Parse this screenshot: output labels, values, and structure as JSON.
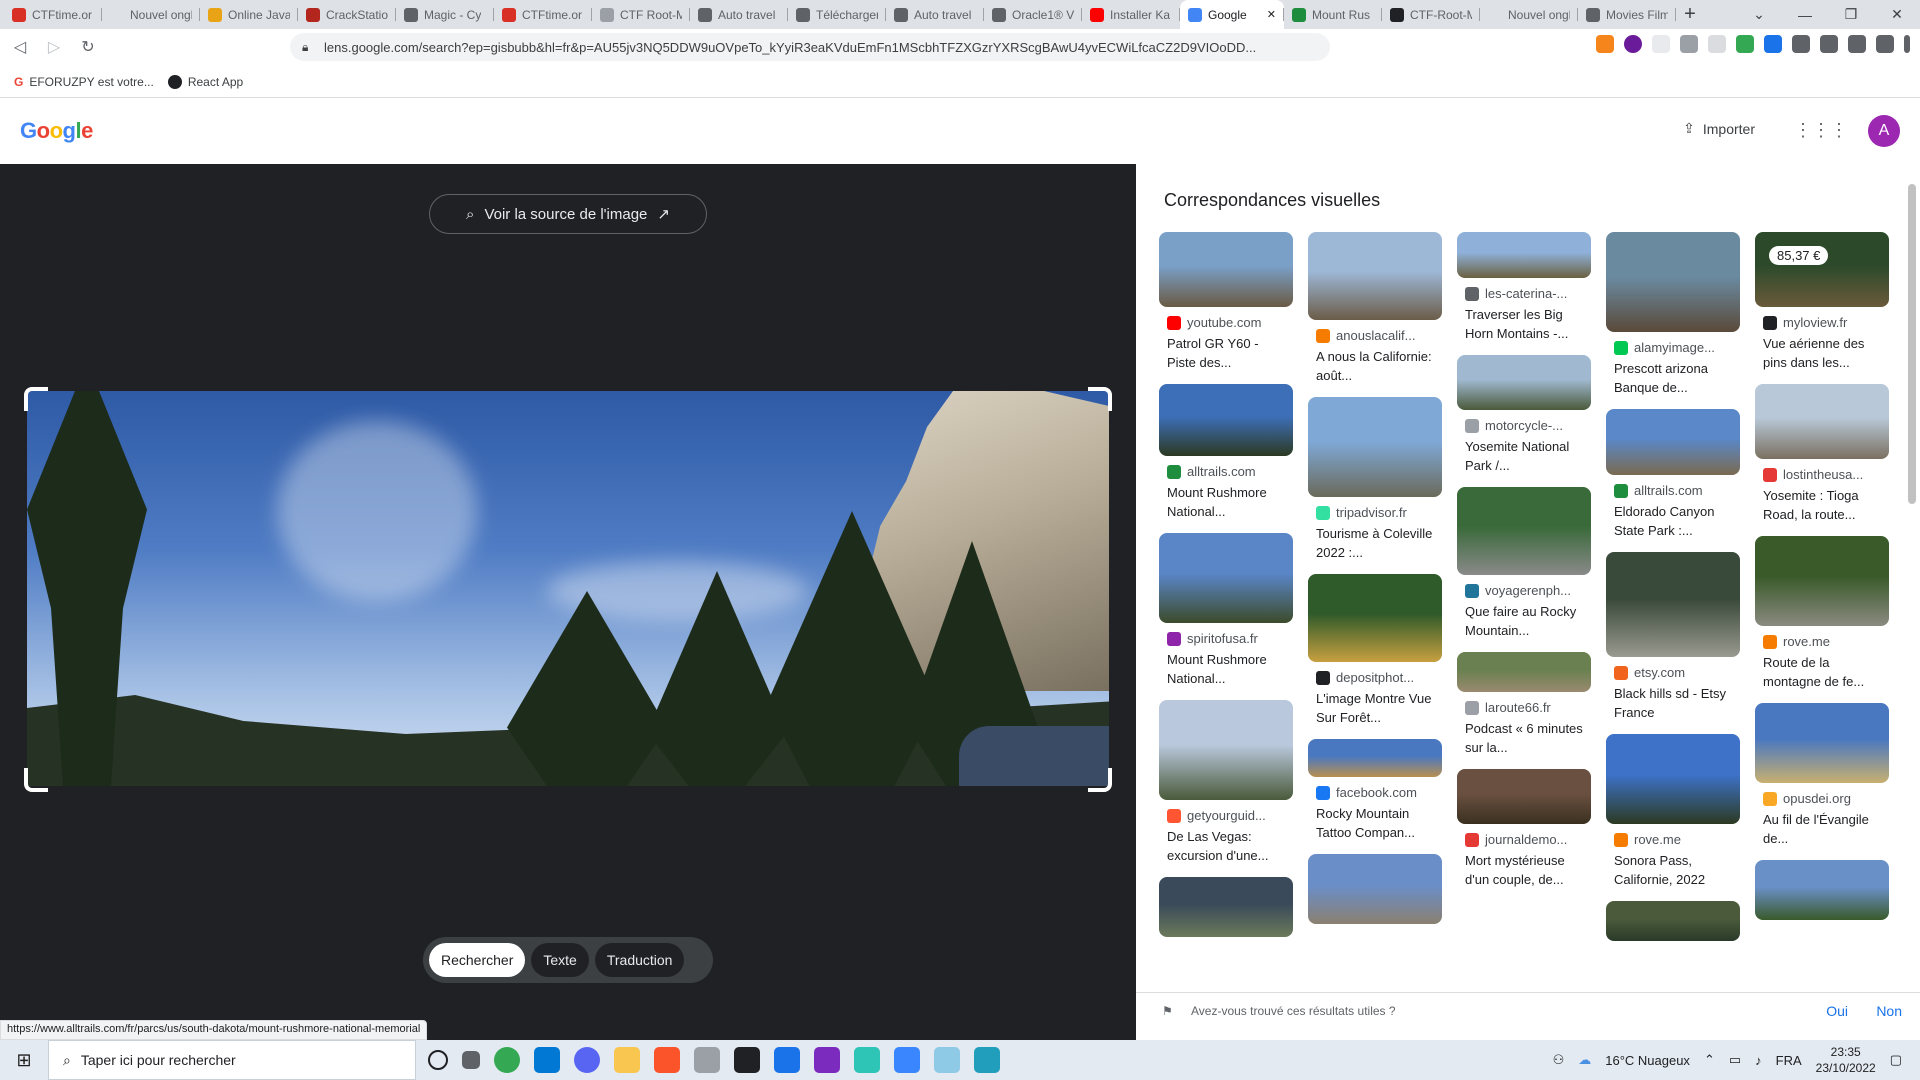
{
  "browser": {
    "tabs": [
      {
        "label": "CTFtime.or",
        "color": "#d93025"
      },
      {
        "label": "Nouvel onglet",
        "color": ""
      },
      {
        "label": "Online Java",
        "color": "#e8a317"
      },
      {
        "label": "CrackStatio",
        "color": "#b3261e"
      },
      {
        "label": "Magic - Cy",
        "color": "#5f6368"
      },
      {
        "label": "CTFtime.or",
        "color": "#d93025"
      },
      {
        "label": "CTF Root-M",
        "color": "#9aa0a6"
      },
      {
        "label": "Auto travel",
        "color": "#5f6368"
      },
      {
        "label": "Télécharger",
        "color": "#5f6368"
      },
      {
        "label": "Auto travel",
        "color": "#5f6368"
      },
      {
        "label": "Oracle1® V",
        "color": "#5f6368"
      },
      {
        "label": "Installer Ka",
        "color": "#ff0000"
      },
      {
        "label": "Google",
        "color": "#4285f4",
        "active": true
      },
      {
        "label": "Mount Rus",
        "color": "#1e8e3e"
      },
      {
        "label": "CTF-Root-M",
        "color": "#202124"
      },
      {
        "label": "Nouvel onglet",
        "color": ""
      },
      {
        "label": "Movies Film",
        "color": "#5f6368"
      }
    ],
    "close_glyph": "✕",
    "new_tab_glyph": "+",
    "url": "lens.google.com/search?ep=gisbubb&hl=fr&p=AU55jv3NQ5DDW9uOVpeTo_kYyiR3eaKVduEmFn1MScbhTFZXGzrYXRScgBAwU4yvECWiLfcaCZ2D9VIOoDD...",
    "bookmarks": [
      "EFORUZPY est votre...",
      "React App"
    ],
    "status_url": "https://www.alltrails.com/fr/parcs/us/south-dakota/mount-rushmore-national-memorial"
  },
  "header": {
    "logo": "Google",
    "import_label": "Importer",
    "avatar_letter": "A"
  },
  "viewer": {
    "source_button": "Voir la source de l'image",
    "modes": [
      "Rechercher",
      "Texte",
      "Traduction"
    ]
  },
  "results": {
    "title": "Correspondances visuelles",
    "columns": [
      [
        {
          "source": "youtube.com",
          "title": "Patrol GR Y60 - Piste des...",
          "icon_color": "#ff0000",
          "h": 75,
          "c1": "#7aa0c8",
          "c2": "#6a5a44"
        },
        {
          "source": "alltrails.com",
          "title": "Mount Rushmore National...",
          "icon_color": "#1e8e3e",
          "h": 72,
          "c1": "#3d6fb8",
          "c2": "#2c3a22"
        },
        {
          "source": "spiritofusa.fr",
          "title": "Mount Rushmore National...",
          "icon_color": "#8e24aa",
          "h": 90,
          "c1": "#5a86c8",
          "c2": "#3c4b2a"
        },
        {
          "source": "getyourguid...",
          "title": "De Las Vegas: excursion d'une...",
          "icon_color": "#ff5533",
          "h": 100,
          "c1": "#b9c8dc",
          "c2": "#4a5a3a"
        },
        {
          "source": "",
          "title": "",
          "icon_color": "#5f6368",
          "h": 60,
          "c1": "#3a4a5a",
          "c2": "#6b7a5a"
        }
      ],
      [
        {
          "source": "anouslacalif...",
          "title": "A nous la Californie: août...",
          "icon_color": "#f57c00",
          "h": 88,
          "c1": "#9db7d6",
          "c2": "#6b5c48"
        },
        {
          "source": "tripadvisor.fr",
          "title": "Tourisme à Coleville 2022 :...",
          "icon_color": "#34e0a1",
          "h": 100,
          "c1": "#7fa8d6",
          "c2": "#6a6a5a"
        },
        {
          "source": "depositphot...",
          "title": "L'image Montre Vue Sur Forêt...",
          "icon_color": "#202124",
          "h": 88,
          "c1": "#2f5a2a",
          "c2": "#c8a040"
        },
        {
          "source": "facebook.com",
          "title": "Rocky Mountain Tattoo Compan...",
          "icon_color": "#1877f2",
          "h": 38,
          "c1": "#4a78c0",
          "c2": "#b89050"
        },
        {
          "source": "",
          "title": "",
          "icon_color": "#5f6368",
          "h": 70,
          "c1": "#6a8ec8",
          "c2": "#8a8070"
        }
      ],
      [
        {
          "source": "les-caterina-...",
          "title": "Traverser les Big Horn Montains -...",
          "icon_color": "#5f6368",
          "h": 46,
          "c1": "#8fb0d8",
          "c2": "#6a6040"
        },
        {
          "source": "motorcycle-...",
          "title": "Yosemite National Park /...",
          "icon_color": "#9aa0a6",
          "h": 55,
          "c1": "#a0b8d0",
          "c2": "#4a5a3a"
        },
        {
          "source": "voyagerenph...",
          "title": "Que faire au Rocky Mountain...",
          "icon_color": "#21759b",
          "h": 88,
          "c1": "#3a6a3a",
          "c2": "#8a8a8a"
        },
        {
          "source": "laroute66.fr",
          "title": "Podcast « 6 minutes sur la...",
          "icon_color": "#9aa0a6",
          "h": 40,
          "c1": "#6a8050",
          "c2": "#9a8a70"
        },
        {
          "source": "journaldemo...",
          "title": "Mort mystérieuse d'un couple, de...",
          "icon_color": "#e53935",
          "h": 55,
          "c1": "#6a5040",
          "c2": "#3a3020"
        }
      ],
      [
        {
          "source": "alamyimage...",
          "title": "Prescott arizona Banque de...",
          "icon_color": "#00c853",
          "h": 100,
          "c1": "#6a8aa0",
          "c2": "#5a4a3a"
        },
        {
          "source": "alltrails.com",
          "title": "Eldorado Canyon State Park :...",
          "icon_color": "#1e8e3e",
          "h": 66,
          "c1": "#5a88c8",
          "c2": "#7a6a50"
        },
        {
          "source": "etsy.com",
          "title": "Black hills sd - Etsy France",
          "icon_color": "#f1641e",
          "h": 105,
          "c1": "#3a4a3a",
          "c2": "#9a9a90"
        },
        {
          "source": "rove.me",
          "title": "Sonora Pass, Californie, 2022",
          "icon_color": "#f57c00",
          "h": 90,
          "c1": "#3d72c8",
          "c2": "#2c3a22"
        },
        {
          "source": "",
          "title": "",
          "icon_color": "#5f6368",
          "h": 40,
          "c1": "#4a5a3a",
          "c2": "#2a3a2a"
        }
      ],
      [
        {
          "source": "myloview.fr",
          "title": "Vue aérienne des pins dans les...",
          "icon_color": "#202124",
          "h": 75,
          "c1": "#2c4a2a",
          "c2": "#6a5a3a",
          "price": "85,37 €"
        },
        {
          "source": "lostintheusa...",
          "title": "Yosemite : Tioga Road, la route...",
          "icon_color": "#e53935",
          "h": 75,
          "c1": "#b8c8d8",
          "c2": "#7a7060"
        },
        {
          "source": "rove.me",
          "title": "Route de la montagne de fe...",
          "icon_color": "#f57c00",
          "h": 90,
          "c1": "#3a5a2a",
          "c2": "#8a8a80"
        },
        {
          "source": "opusdei.org",
          "title": "Au fil de l'Évangile de...",
          "icon_color": "#f9a825",
          "h": 80,
          "c1": "#4a78c0",
          "c2": "#c8b070"
        },
        {
          "source": "",
          "title": "",
          "icon_color": "#5f6368",
          "h": 60,
          "c1": "#6a90c8",
          "c2": "#3a5a2a"
        }
      ]
    ]
  },
  "feedback": {
    "question": "Avez-vous trouvé ces résultats utiles ?",
    "yes": "Oui",
    "no": "Non"
  },
  "taskbar": {
    "search_placeholder": "Taper ici pour rechercher",
    "weather": "16°C  Nuageux",
    "lang": "FRA",
    "time": "23:35",
    "date": "23/10/2022"
  }
}
